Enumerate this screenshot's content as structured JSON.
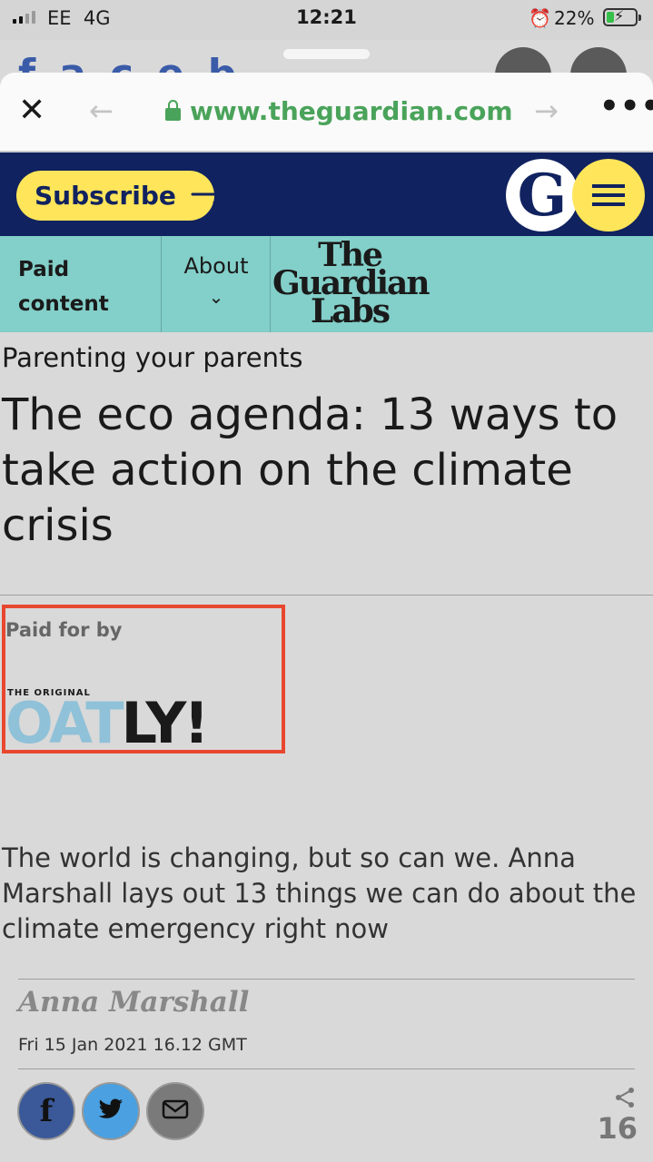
{
  "status_bar": {
    "carrier": "EE",
    "network": "4G",
    "time": "12:21",
    "battery_percent": "22%"
  },
  "background_peek": {
    "text": "faceb"
  },
  "browser": {
    "url": "www.theguardian.com"
  },
  "guardian_header": {
    "subscribe_label": "Subscribe",
    "logo_letter": "G"
  },
  "labs_bar": {
    "paid_content_label": "Paid content",
    "about_label": "About",
    "labs_logo_lines": [
      "The",
      "Guardian",
      "Labs"
    ]
  },
  "article": {
    "kicker": "Parenting your parents",
    "headline": "The eco agenda: 13 ways to take action on the climate crisis",
    "paid_for_label": "Paid for by",
    "sponsor_tagline": "THE ORIGINAL",
    "sponsor_logo_light": "OAT",
    "sponsor_logo_dark": "LY!",
    "standfirst": "The world is changing, but so can we. Anna Marshall lays out 13 things we can do about the climate emergency right now",
    "author": "Anna Marshall",
    "date": "Fri 15 Jan 2021 16.12 GMT",
    "share_count": "16"
  },
  "colors": {
    "guardian_navy": "#10225f",
    "subscribe_yellow": "#ffe55a",
    "labs_teal": "#83cfc9",
    "url_green": "#4aa35a",
    "highlight_red": "#e8472f",
    "facebook_blue": "#3b5998",
    "twitter_blue": "#4aa0e0"
  },
  "icons": [
    "signal-icon",
    "alarm-icon",
    "battery-icon",
    "close-icon",
    "back-arrow-icon",
    "lock-icon",
    "forward-arrow-icon",
    "more-icon",
    "arrow-right-icon",
    "hamburger-menu-icon",
    "chevron-down-icon",
    "facebook-icon",
    "twitter-icon",
    "email-icon",
    "share-icon"
  ]
}
